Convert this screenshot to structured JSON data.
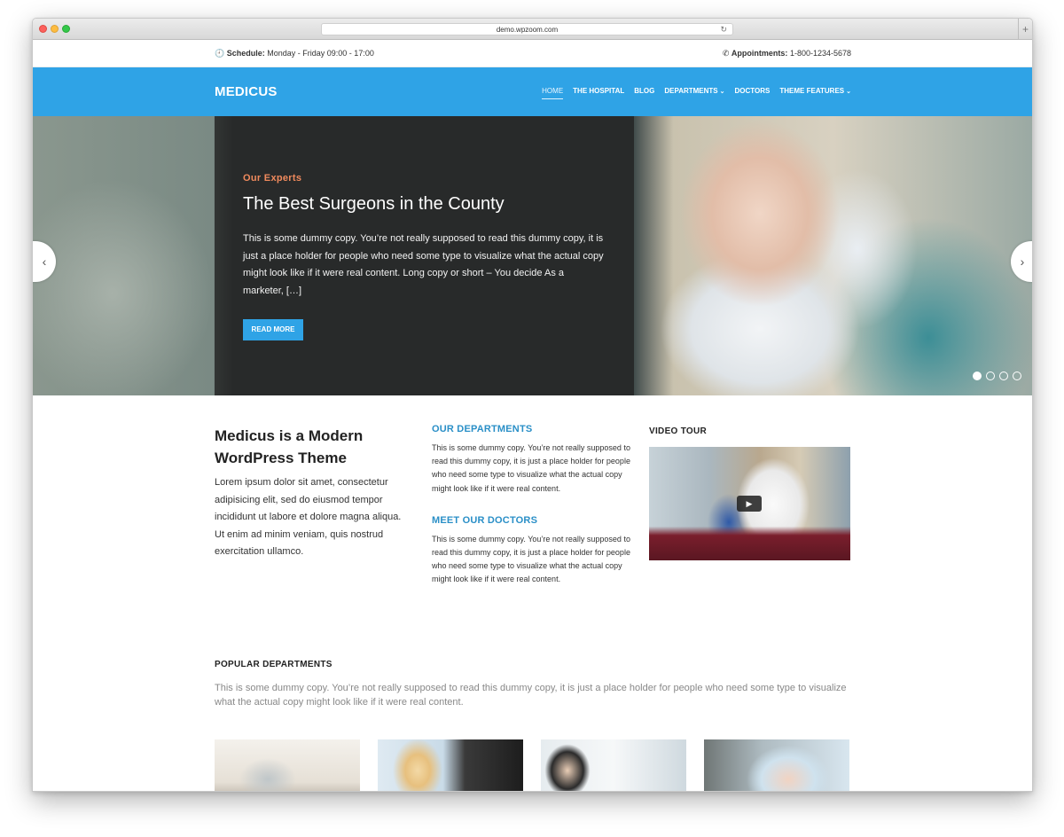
{
  "browser": {
    "url": "demo.wpzoom.com"
  },
  "topbar": {
    "schedule_label": "Schedule:",
    "schedule_value": "Monday - Friday 09:00 - 17:00",
    "appointments_label": "Appointments:",
    "appointments_value": "1-800-1234-5678"
  },
  "nav": {
    "logo": "MEDICUS",
    "items": [
      {
        "label": "HOME"
      },
      {
        "label": "THE HOSPITAL"
      },
      {
        "label": "BLOG"
      },
      {
        "label": "DEPARTMENTS"
      },
      {
        "label": "DOCTORS"
      },
      {
        "label": "THEME FEATURES"
      }
    ]
  },
  "hero": {
    "kicker": "Our Experts",
    "title": "The Best Surgeons in the County",
    "text": "This is some dummy copy. You’re not really supposed to read this dummy copy, it is just a place holder for people who need some type to visualize what the actual copy might look like if it were real content. Long copy or short – You decide As a marketer, […]",
    "button": "READ MORE",
    "slides_total": 4,
    "active_slide": 1
  },
  "about": {
    "title": "Medicus is a Modern WordPress Theme",
    "text": "Lorem ipsum dolor sit amet, consectetur adipisicing elit, sed do eiusmod tempor incididunt ut labore et dolore magna aliqua. Ut enim ad minim veniam, quis nostrud exercitation ullamco."
  },
  "departments": {
    "title": "OUR DEPARTMENTS",
    "text": "This is some dummy copy. You’re not really supposed to read this dummy copy, it is just a place holder for people who need some type to visualize what the actual copy might look like if it were real content."
  },
  "doctors": {
    "title": "MEET OUR DOCTORS",
    "text": "This is some dummy copy. You’re not really supposed to read this dummy copy, it is just a place holder for people who need some type to visualize what the actual copy might look like if it were real content."
  },
  "video": {
    "title": "VIDEO TOUR"
  },
  "popular": {
    "title": "POPULAR DEPARTMENTS",
    "text": "This is some dummy copy. You’re not really supposed to read this dummy copy, it is just a place holder for people who need some type to visualize what the actual copy might look like if it were real content."
  },
  "icons": {
    "clock": "clock-icon",
    "phone": "phone-icon",
    "prev": "chevron-left-icon",
    "next": "chevron-right-icon",
    "play": "play-icon"
  },
  "colors": {
    "brand_blue": "#2fa3e6",
    "kicker_orange": "#f08a5d",
    "heading_blue": "#2a8fc7"
  }
}
